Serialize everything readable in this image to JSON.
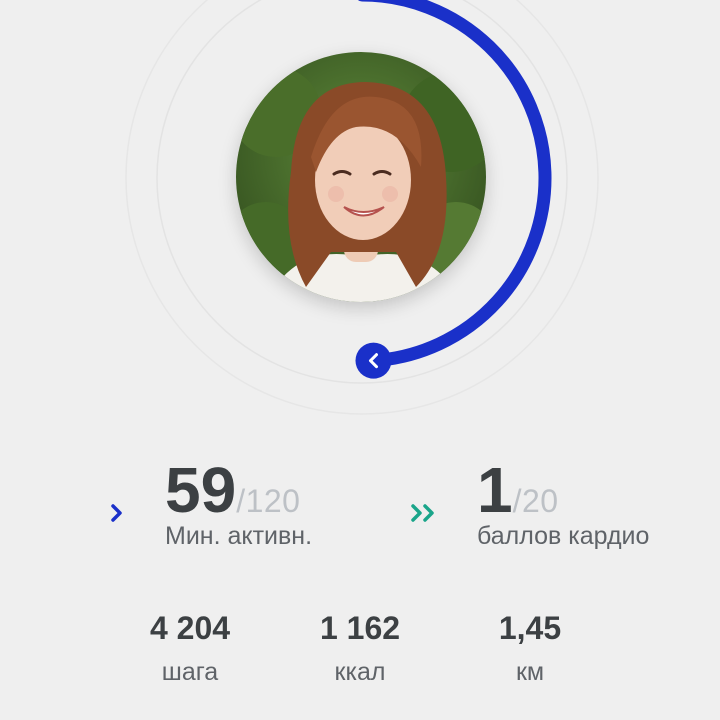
{
  "progress": {
    "active_minutes_fraction": 0.49,
    "ring_color": "#1a30c9",
    "cardio_color": "#1aa58a"
  },
  "avatar": {
    "icon": "profile-photo"
  },
  "stats": {
    "move_minutes": {
      "value": "59",
      "goal": "/120",
      "label": "Мин. активн.",
      "icon": "chevron-right-icon"
    },
    "heart_points": {
      "value": "1",
      "goal": "/20",
      "label": "баллов кардио",
      "icon": "double-chevron-right-icon"
    }
  },
  "metrics": {
    "steps": {
      "value": "4 204",
      "label": "шага"
    },
    "calories": {
      "value": "1 162",
      "label": "ккал"
    },
    "distance": {
      "value": "1,45",
      "label": "км"
    }
  }
}
